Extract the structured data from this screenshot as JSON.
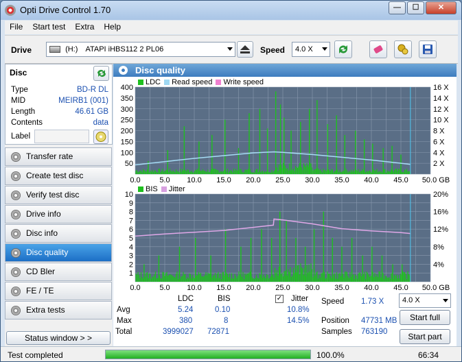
{
  "window": {
    "title": "Opti Drive Control 1.70"
  },
  "menu": [
    "File",
    "Start test",
    "Extra",
    "Help"
  ],
  "toolbar": {
    "drive_label": "Drive",
    "drive_letter": "(H:)",
    "drive_value": "ATAPI iHBS112  2 PL06",
    "speed_label": "Speed",
    "speed_value": "4.0 X"
  },
  "disc": {
    "header": "Disc",
    "rows": [
      {
        "key": "Type",
        "value": "BD-R DL"
      },
      {
        "key": "MID",
        "value": "MEIRB1 (001)"
      },
      {
        "key": "Length",
        "value": "46.61 GB"
      },
      {
        "key": "Contents",
        "value": "data"
      }
    ],
    "label_key": "Label"
  },
  "nav": [
    {
      "label": "Transfer rate",
      "active": false
    },
    {
      "label": "Create test disc",
      "active": false
    },
    {
      "label": "Verify test disc",
      "active": false
    },
    {
      "label": "Drive info",
      "active": false
    },
    {
      "label": "Disc info",
      "active": false
    },
    {
      "label": "Disc quality",
      "active": true
    },
    {
      "label": "CD Bler",
      "active": false
    },
    {
      "label": "FE / TE",
      "active": false
    },
    {
      "label": "Extra tests",
      "active": false
    }
  ],
  "status_window_label": "Status window > >",
  "main_title": "Disc quality",
  "chart_data": [
    {
      "type": "bar",
      "legend": [
        "LDC",
        "Read speed",
        "Write speed"
      ],
      "colors": {
        "LDC": "#1fc01f",
        "Read speed": "#9fd8f2",
        "Write speed": "#f080d0"
      },
      "xlim": [
        0,
        50
      ],
      "x_ticks": [
        "0.0",
        "5.0",
        "10.0",
        "15.0",
        "20.0",
        "25.0",
        "30.0",
        "35.0",
        "40.0",
        "45.0",
        "50.0 GB"
      ],
      "ylim": [
        0,
        400
      ],
      "y_ticks": [
        "400",
        "350",
        "300",
        "250",
        "200",
        "150",
        "100",
        "50"
      ],
      "y2_ticks": [
        "16 X",
        "14 X",
        "12 X",
        "10 X",
        "8 X",
        "6 X",
        "4 X",
        "2 X"
      ],
      "y2lim": [
        0,
        16
      ],
      "data_end_gb": 46.61,
      "read_speed": {
        "x": [
          0,
          5,
          10,
          15,
          20,
          23.5,
          25,
          30,
          35,
          40,
          45,
          46.6
        ],
        "y": [
          1.7,
          2.3,
          2.9,
          3.4,
          3.9,
          4.1,
          4.0,
          3.6,
          3.1,
          2.6,
          2.0,
          1.8
        ]
      },
      "ldc_peaks": {
        "x": [
          2.2,
          5.5,
          8.3,
          10.8,
          13.0,
          15.2,
          17.5,
          19.3,
          21.1,
          22.4,
          23.8,
          24.6,
          25.2,
          26.4,
          28.0,
          29.5,
          30.8,
          32.6,
          34.1,
          35.5,
          37.3,
          38.8,
          40.2,
          42.0,
          43.5,
          45.0
        ],
        "y": [
          60,
          110,
          220,
          150,
          180,
          250,
          120,
          280,
          300,
          210,
          380,
          320,
          260,
          200,
          240,
          300,
          340,
          230,
          270,
          180,
          200,
          160,
          140,
          120,
          130,
          90
        ]
      }
    },
    {
      "type": "bar",
      "legend": [
        "BIS",
        "Jitter"
      ],
      "colors": {
        "BIS": "#1fc01f",
        "Jitter": "#d8a0e0"
      },
      "xlim": [
        0,
        50
      ],
      "x_ticks": [
        "0.0",
        "5.0",
        "10.0",
        "15.0",
        "20.0",
        "25.0",
        "30.0",
        "35.0",
        "40.0",
        "45.0",
        "50.0 GB"
      ],
      "ylim": [
        0,
        10
      ],
      "y_ticks": [
        "10",
        "9",
        "8",
        "7",
        "6",
        "5",
        "4",
        "3",
        "2",
        "1"
      ],
      "y2_ticks": [
        "20%",
        "16%",
        "12%",
        "8%",
        "4%"
      ],
      "y2lim": [
        0,
        20
      ],
      "jitter": {
        "x": [
          0,
          5,
          10,
          15,
          20,
          23.4,
          23.5,
          25,
          30,
          35,
          40,
          45,
          46.6
        ],
        "y": [
          10.4,
          10.9,
          11.3,
          11.7,
          12.4,
          12.9,
          14.3,
          14.1,
          13.2,
          12.1,
          11.6,
          11.2,
          11.0
        ]
      },
      "bis_peaks": {
        "x": [
          1.5,
          4.0,
          7.5,
          10.2,
          12.8,
          15.3,
          17.9,
          19.6,
          21.4,
          23.1,
          24.5,
          25.6,
          27.2,
          28.8,
          30.3,
          31.9,
          33.4,
          35.0,
          36.7,
          38.5,
          40.1,
          41.8,
          43.6,
          45.2
        ],
        "y": [
          2,
          3,
          4,
          5,
          3,
          6,
          4,
          5,
          6,
          5,
          8,
          7,
          5,
          4,
          6,
          8,
          5,
          4,
          5,
          3,
          4,
          3,
          2,
          2
        ]
      }
    }
  ],
  "stats": {
    "col_ldc": "LDC",
    "col_bis": "BIS",
    "jitter_label": "Jitter",
    "jitter_checked": true,
    "rows": [
      {
        "label": "Avg",
        "ldc": "5.24",
        "bis": "0.10",
        "jitter": "10.8%"
      },
      {
        "label": "Max",
        "ldc": "380",
        "bis": "8",
        "jitter": "14.5%"
      },
      {
        "label": "Total",
        "ldc": "3999027",
        "bis": "72871",
        "jitter": ""
      }
    ],
    "speed_label": "Speed",
    "speed_value": "1.73 X",
    "position_label": "Position",
    "position_value": "47731 MB",
    "samples_label": "Samples",
    "samples_value": "763190",
    "speed_select": "4.0 X",
    "start_full": "Start full",
    "start_part": "Start part"
  },
  "statusbar": {
    "text": "Test completed",
    "progress": 100.0,
    "progress_text": "100.0%",
    "time": "66:34"
  }
}
